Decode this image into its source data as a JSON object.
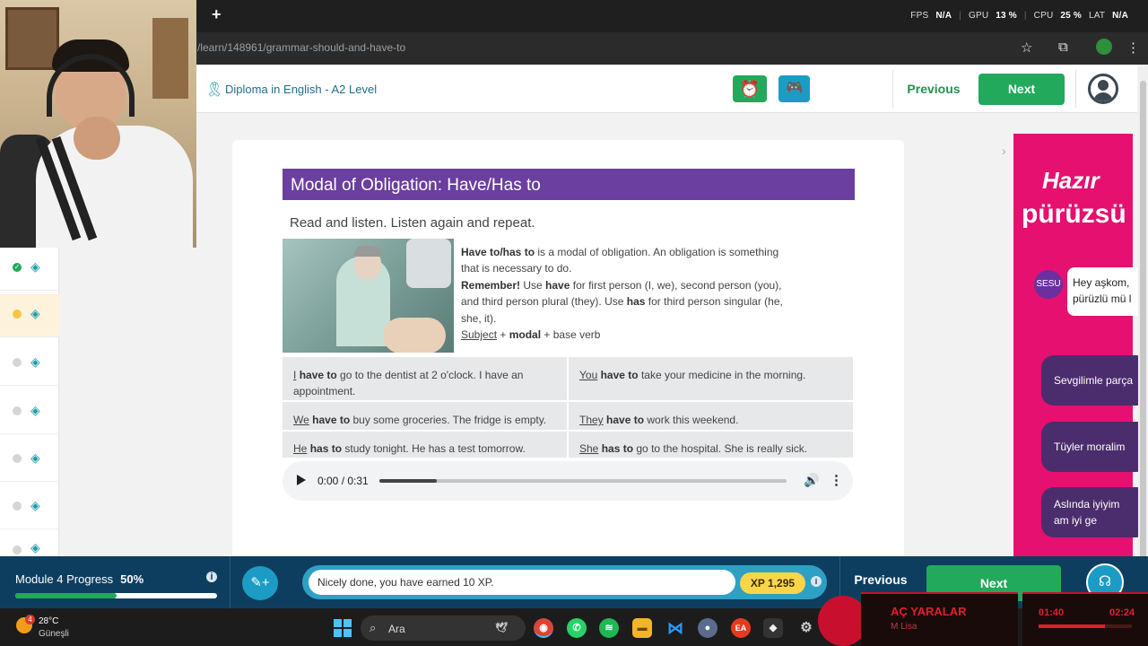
{
  "browser": {
    "new_tab": "+",
    "url": "/learn/148961/grammar-should-and-have-to",
    "stats": {
      "fps_label": "FPS",
      "fps": "N/A",
      "gpu_label": "GPU",
      "gpu": "13 %",
      "cpu_label": "CPU",
      "cpu": "25 %",
      "lat_label": "LAT",
      "lat": "N/A"
    }
  },
  "header": {
    "course_title": "Diploma in English - A2 Level",
    "previous": "Previous",
    "next": "Next"
  },
  "lesson": {
    "title": "Modal of Obligation: Have/Has to",
    "instruction": "Read and listen. Listen again and repeat.",
    "explain": {
      "l1_b": "Have to/has to",
      "l1": " is a modal of obligation. An obligation is something that is necessary to do.",
      "l2_b": "Remember!",
      "l2a": " Use ",
      "l2_have": "have",
      "l2b": " for first person (I, we), second person (you), and third person plural (they).  Use ",
      "l2_has": "has",
      "l2c": " for third person singular (he, she, it).",
      "l3_subject": "Subject",
      "l3_plus1": " + ",
      "l3_modal": "modal",
      "l3_rest": " + base verb"
    },
    "examples": [
      {
        "subj": "I",
        "modal": "have to",
        "rest": " go to the dentist at 2 o'clock. I have an appointment."
      },
      {
        "subj": "You",
        "modal": "have to",
        "rest": " take your medicine in the morning."
      },
      {
        "subj": "We",
        "modal": "have to",
        "rest": " buy some groceries. The fridge is empty."
      },
      {
        "subj": "They",
        "modal": "have to",
        "rest": " work this weekend."
      },
      {
        "subj": "He",
        "modal": "has to",
        "rest": " study tonight. He has a test tomorrow."
      },
      {
        "subj": "She",
        "modal": "has to",
        "rest": " go to the hospital. She is really sick."
      }
    ],
    "audio": {
      "time": "0:00 / 0:31",
      "progress": 0.14
    }
  },
  "ad": {
    "headline1": "Hazır",
    "headline2": "pürüzsü",
    "avatar": "SESU",
    "bubble": "Hey aşkom, pürüzlü mü l",
    "pills": [
      "Sevgilimle parça",
      "Tüyler moralim",
      "Aslında iyiyim am iyi ge"
    ]
  },
  "bottom": {
    "progress_label": "Module 4 Progress",
    "progress_pct": "50%",
    "progress_value": 0.5,
    "message": "Nicely done, you have earned 10 XP.",
    "xp": "XP 1,295",
    "previous": "Previous",
    "next": "Next"
  },
  "taskbar": {
    "temp": "28°C",
    "condition": "Güneşli",
    "weather_badge": "4",
    "search": "Ara"
  },
  "music": {
    "title": "AÇ YARALAR",
    "artist": "M Lisa",
    "current": "01:40",
    "total": "02:24"
  },
  "colors": {
    "purple": "#6b3fa0",
    "green": "#22a95b",
    "navy": "#0e3e5f",
    "teal": "#1c9cc4",
    "ad_pink": "#e5106f"
  }
}
